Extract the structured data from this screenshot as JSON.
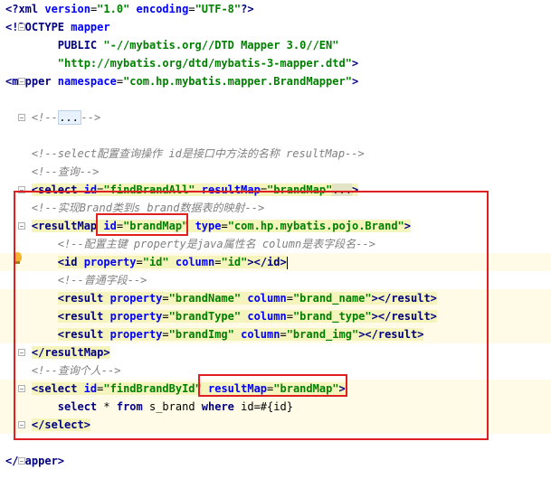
{
  "editor": {
    "lines": [
      {
        "parts": [
          [
            "t-tag",
            "<?"
          ],
          [
            "t-tag",
            "xml "
          ],
          [
            "t-attr",
            "version"
          ],
          [
            "t-text",
            "="
          ],
          [
            "t-val",
            "\"1.0\""
          ],
          [
            "t-text",
            " "
          ],
          [
            "t-attr",
            "encoding"
          ],
          [
            "t-text",
            "="
          ],
          [
            "t-val",
            "\"UTF-8\""
          ],
          [
            "t-tag",
            "?>"
          ]
        ]
      },
      {
        "parts": [
          [
            "t-tag",
            "<!DOCTYPE "
          ],
          [
            "t-attr",
            "mapper"
          ]
        ]
      },
      {
        "parts": [
          [
            "t-text",
            "        "
          ],
          [
            "t-tag",
            "PUBLIC "
          ],
          [
            "t-val",
            "\"-//mybatis.org//DTD Mapper 3.0//EN\""
          ]
        ]
      },
      {
        "parts": [
          [
            "t-text",
            "        "
          ],
          [
            "t-val",
            "\"http://mybatis.org/dtd/mybatis-3-mapper.dtd\""
          ],
          [
            "t-tag",
            ">"
          ]
        ]
      },
      {
        "parts": [
          [
            "t-tag",
            "<mapper "
          ],
          [
            "t-attr",
            "namespace"
          ],
          [
            "t-text",
            "="
          ],
          [
            "t-val",
            "\"com.hp.mybatis.mapper.BrandMapper\""
          ],
          [
            "t-tag",
            ">"
          ]
        ]
      },
      {
        "parts": []
      },
      {
        "parts": [
          [
            "t-text",
            "    "
          ],
          [
            "t-cmt",
            "<!--"
          ],
          [
            "fold",
            "..."
          ],
          [
            "t-cmt",
            "-->"
          ]
        ]
      },
      {
        "parts": []
      },
      {
        "parts": [
          [
            "t-text",
            "    "
          ],
          [
            "t-cmt",
            "<!--select配置查询操作 id是接口中方法的名称 resultMap-->"
          ]
        ]
      },
      {
        "parts": [
          [
            "t-text",
            "    "
          ],
          [
            "t-cmt",
            "<!--查询-->"
          ]
        ]
      },
      {
        "parts": [
          [
            "t-text",
            "    "
          ],
          [
            "t-tag",
            "<select "
          ],
          [
            "t-attr",
            "id"
          ],
          [
            "t-text",
            "="
          ],
          [
            "t-val",
            "\"findBrandAll\""
          ],
          [
            "t-text",
            " "
          ],
          [
            "t-attr",
            "resultMap"
          ],
          [
            "t-text",
            "="
          ],
          [
            "t-val",
            "\"brandMap\""
          ],
          [
            "fold-dots",
            "..."
          ],
          [
            "t-tag",
            ">"
          ]
        ]
      },
      {
        "parts": [
          [
            "t-text",
            "    "
          ],
          [
            "t-cmt",
            "<!--实现Brand类到s_brand数据表的映射-->"
          ]
        ]
      },
      {
        "parts": [
          [
            "t-text",
            "    "
          ],
          [
            "t-tag",
            "<resultMap "
          ],
          [
            "t-attr",
            "id"
          ],
          [
            "t-text",
            "="
          ],
          [
            "t-val",
            "\"brandMap\""
          ],
          [
            "t-text",
            " "
          ],
          [
            "t-attr",
            "type"
          ],
          [
            "t-text",
            "="
          ],
          [
            "t-val",
            "\"com.hp.mybatis.pojo.Brand\""
          ],
          [
            "t-tag",
            ">"
          ]
        ]
      },
      {
        "parts": [
          [
            "t-text",
            "        "
          ],
          [
            "t-cmt",
            "<!--配置主键 property是java属性名 column是表字段名-->"
          ]
        ]
      },
      {
        "parts": [
          [
            "t-text",
            "        "
          ],
          [
            "t-tag",
            "<id "
          ],
          [
            "t-attr",
            "property"
          ],
          [
            "t-text",
            "="
          ],
          [
            "t-val",
            "\"id\""
          ],
          [
            "t-text",
            " "
          ],
          [
            "t-attr",
            "column"
          ],
          [
            "t-text",
            "="
          ],
          [
            "t-val",
            "\"id\""
          ],
          [
            "t-tag",
            "></id>"
          ],
          [
            "caret",
            ""
          ]
        ]
      },
      {
        "parts": [
          [
            "t-text",
            "        "
          ],
          [
            "t-cmt",
            "<!--普通字段-->"
          ]
        ]
      },
      {
        "parts": [
          [
            "t-text",
            "        "
          ],
          [
            "t-tag",
            "<result "
          ],
          [
            "t-attr",
            "property"
          ],
          [
            "t-text",
            "="
          ],
          [
            "t-val",
            "\"brandName\""
          ],
          [
            "t-text",
            " "
          ],
          [
            "t-attr",
            "column"
          ],
          [
            "t-text",
            "="
          ],
          [
            "t-val",
            "\"brand_name\""
          ],
          [
            "t-tag",
            "></result>"
          ]
        ]
      },
      {
        "parts": [
          [
            "t-text",
            "        "
          ],
          [
            "t-tag",
            "<result "
          ],
          [
            "t-attr",
            "property"
          ],
          [
            "t-text",
            "="
          ],
          [
            "t-val",
            "\"brandType\""
          ],
          [
            "t-text",
            " "
          ],
          [
            "t-attr",
            "column"
          ],
          [
            "t-text",
            "="
          ],
          [
            "t-val",
            "\"brand_type\""
          ],
          [
            "t-tag",
            "></result>"
          ]
        ]
      },
      {
        "parts": [
          [
            "t-text",
            "        "
          ],
          [
            "t-tag",
            "<result "
          ],
          [
            "t-attr",
            "property"
          ],
          [
            "t-text",
            "="
          ],
          [
            "t-val",
            "\"brandImg\""
          ],
          [
            "t-text",
            " "
          ],
          [
            "t-attr",
            "column"
          ],
          [
            "t-text",
            "="
          ],
          [
            "t-val",
            "\"brand_img\""
          ],
          [
            "t-tag",
            "></result>"
          ]
        ]
      },
      {
        "parts": [
          [
            "t-text",
            "    "
          ],
          [
            "t-tag",
            "</resultMap>"
          ]
        ]
      },
      {
        "parts": [
          [
            "t-text",
            "    "
          ],
          [
            "t-cmt",
            "<!--查询个人-->"
          ]
        ]
      },
      {
        "parts": [
          [
            "t-text",
            "    "
          ],
          [
            "t-tag",
            "<select "
          ],
          [
            "t-attr",
            "id"
          ],
          [
            "t-text",
            "="
          ],
          [
            "t-val",
            "\"findBrandById\""
          ],
          [
            "t-text",
            " "
          ],
          [
            "t-attr",
            "resultMap"
          ],
          [
            "t-text",
            "="
          ],
          [
            "t-val",
            "\"brandMap\""
          ],
          [
            "t-tag",
            ">"
          ]
        ]
      },
      {
        "parts": [
          [
            "t-text",
            "        "
          ],
          [
            "t-sql-kw",
            "select"
          ],
          [
            "t-text",
            " * "
          ],
          [
            "t-sql-kw",
            "from"
          ],
          [
            "t-text",
            " s_brand "
          ],
          [
            "t-sql-kw",
            "where"
          ],
          [
            "t-text",
            " id=#{id}"
          ]
        ]
      },
      {
        "parts": [
          [
            "t-text",
            "    "
          ],
          [
            "t-tag",
            "</select>"
          ]
        ]
      },
      {
        "parts": []
      },
      {
        "parts": [
          [
            "t-tag",
            "</mapper>"
          ]
        ]
      }
    ]
  }
}
